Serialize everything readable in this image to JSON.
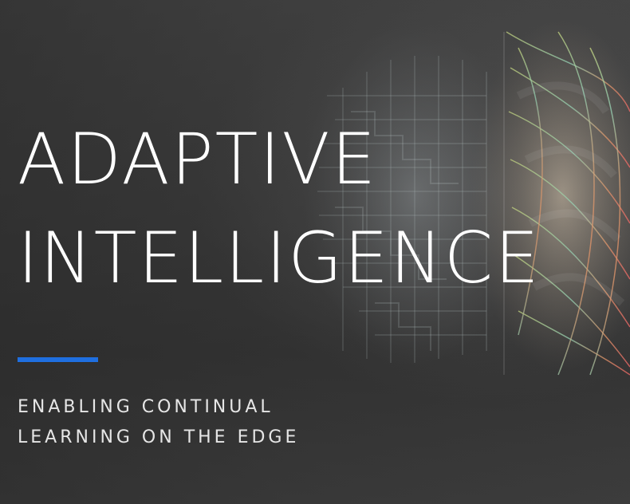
{
  "hero": {
    "title_line_1": "ADAPTIVE",
    "title_line_2": "INTELLIGENCE",
    "subtitle_line_1": "ENABLING CONTINUAL",
    "subtitle_line_2": "LEARNING ON THE EDGE",
    "accent_color": "#1f6fe0",
    "background_image": "brain-half-circuit-half-colorful-wires"
  }
}
